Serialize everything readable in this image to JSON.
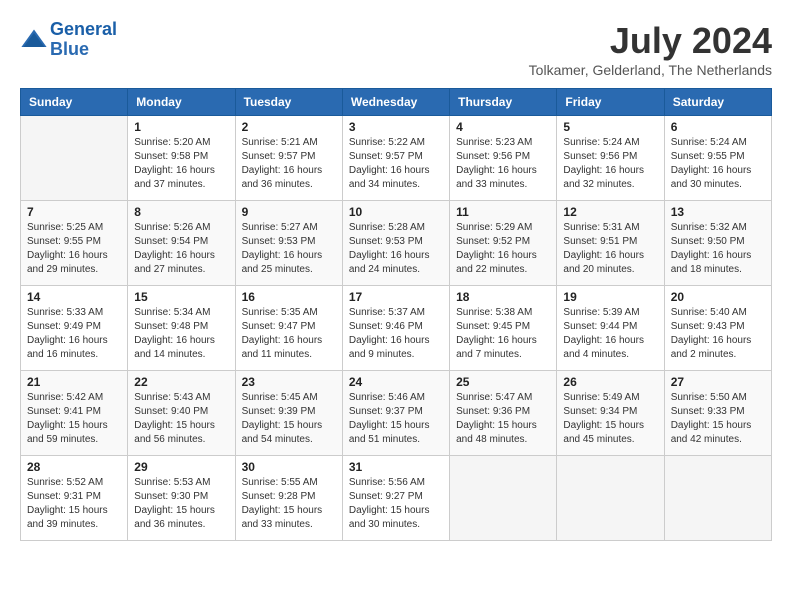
{
  "header": {
    "logo_line1": "General",
    "logo_line2": "Blue",
    "month_year": "July 2024",
    "location": "Tolkamer, Gelderland, The Netherlands"
  },
  "calendar": {
    "days_of_week": [
      "Sunday",
      "Monday",
      "Tuesday",
      "Wednesday",
      "Thursday",
      "Friday",
      "Saturday"
    ],
    "weeks": [
      [
        {
          "day": "",
          "info": ""
        },
        {
          "day": "1",
          "info": "Sunrise: 5:20 AM\nSunset: 9:58 PM\nDaylight: 16 hours\nand 37 minutes."
        },
        {
          "day": "2",
          "info": "Sunrise: 5:21 AM\nSunset: 9:57 PM\nDaylight: 16 hours\nand 36 minutes."
        },
        {
          "day": "3",
          "info": "Sunrise: 5:22 AM\nSunset: 9:57 PM\nDaylight: 16 hours\nand 34 minutes."
        },
        {
          "day": "4",
          "info": "Sunrise: 5:23 AM\nSunset: 9:56 PM\nDaylight: 16 hours\nand 33 minutes."
        },
        {
          "day": "5",
          "info": "Sunrise: 5:24 AM\nSunset: 9:56 PM\nDaylight: 16 hours\nand 32 minutes."
        },
        {
          "day": "6",
          "info": "Sunrise: 5:24 AM\nSunset: 9:55 PM\nDaylight: 16 hours\nand 30 minutes."
        }
      ],
      [
        {
          "day": "7",
          "info": "Sunrise: 5:25 AM\nSunset: 9:55 PM\nDaylight: 16 hours\nand 29 minutes."
        },
        {
          "day": "8",
          "info": "Sunrise: 5:26 AM\nSunset: 9:54 PM\nDaylight: 16 hours\nand 27 minutes."
        },
        {
          "day": "9",
          "info": "Sunrise: 5:27 AM\nSunset: 9:53 PM\nDaylight: 16 hours\nand 25 minutes."
        },
        {
          "day": "10",
          "info": "Sunrise: 5:28 AM\nSunset: 9:53 PM\nDaylight: 16 hours\nand 24 minutes."
        },
        {
          "day": "11",
          "info": "Sunrise: 5:29 AM\nSunset: 9:52 PM\nDaylight: 16 hours\nand 22 minutes."
        },
        {
          "day": "12",
          "info": "Sunrise: 5:31 AM\nSunset: 9:51 PM\nDaylight: 16 hours\nand 20 minutes."
        },
        {
          "day": "13",
          "info": "Sunrise: 5:32 AM\nSunset: 9:50 PM\nDaylight: 16 hours\nand 18 minutes."
        }
      ],
      [
        {
          "day": "14",
          "info": "Sunrise: 5:33 AM\nSunset: 9:49 PM\nDaylight: 16 hours\nand 16 minutes."
        },
        {
          "day": "15",
          "info": "Sunrise: 5:34 AM\nSunset: 9:48 PM\nDaylight: 16 hours\nand 14 minutes."
        },
        {
          "day": "16",
          "info": "Sunrise: 5:35 AM\nSunset: 9:47 PM\nDaylight: 16 hours\nand 11 minutes."
        },
        {
          "day": "17",
          "info": "Sunrise: 5:37 AM\nSunset: 9:46 PM\nDaylight: 16 hours\nand 9 minutes."
        },
        {
          "day": "18",
          "info": "Sunrise: 5:38 AM\nSunset: 9:45 PM\nDaylight: 16 hours\nand 7 minutes."
        },
        {
          "day": "19",
          "info": "Sunrise: 5:39 AM\nSunset: 9:44 PM\nDaylight: 16 hours\nand 4 minutes."
        },
        {
          "day": "20",
          "info": "Sunrise: 5:40 AM\nSunset: 9:43 PM\nDaylight: 16 hours\nand 2 minutes."
        }
      ],
      [
        {
          "day": "21",
          "info": "Sunrise: 5:42 AM\nSunset: 9:41 PM\nDaylight: 15 hours\nand 59 minutes."
        },
        {
          "day": "22",
          "info": "Sunrise: 5:43 AM\nSunset: 9:40 PM\nDaylight: 15 hours\nand 56 minutes."
        },
        {
          "day": "23",
          "info": "Sunrise: 5:45 AM\nSunset: 9:39 PM\nDaylight: 15 hours\nand 54 minutes."
        },
        {
          "day": "24",
          "info": "Sunrise: 5:46 AM\nSunset: 9:37 PM\nDaylight: 15 hours\nand 51 minutes."
        },
        {
          "day": "25",
          "info": "Sunrise: 5:47 AM\nSunset: 9:36 PM\nDaylight: 15 hours\nand 48 minutes."
        },
        {
          "day": "26",
          "info": "Sunrise: 5:49 AM\nSunset: 9:34 PM\nDaylight: 15 hours\nand 45 minutes."
        },
        {
          "day": "27",
          "info": "Sunrise: 5:50 AM\nSunset: 9:33 PM\nDaylight: 15 hours\nand 42 minutes."
        }
      ],
      [
        {
          "day": "28",
          "info": "Sunrise: 5:52 AM\nSunset: 9:31 PM\nDaylight: 15 hours\nand 39 minutes."
        },
        {
          "day": "29",
          "info": "Sunrise: 5:53 AM\nSunset: 9:30 PM\nDaylight: 15 hours\nand 36 minutes."
        },
        {
          "day": "30",
          "info": "Sunrise: 5:55 AM\nSunset: 9:28 PM\nDaylight: 15 hours\nand 33 minutes."
        },
        {
          "day": "31",
          "info": "Sunrise: 5:56 AM\nSunset: 9:27 PM\nDaylight: 15 hours\nand 30 minutes."
        },
        {
          "day": "",
          "info": ""
        },
        {
          "day": "",
          "info": ""
        },
        {
          "day": "",
          "info": ""
        }
      ]
    ]
  }
}
